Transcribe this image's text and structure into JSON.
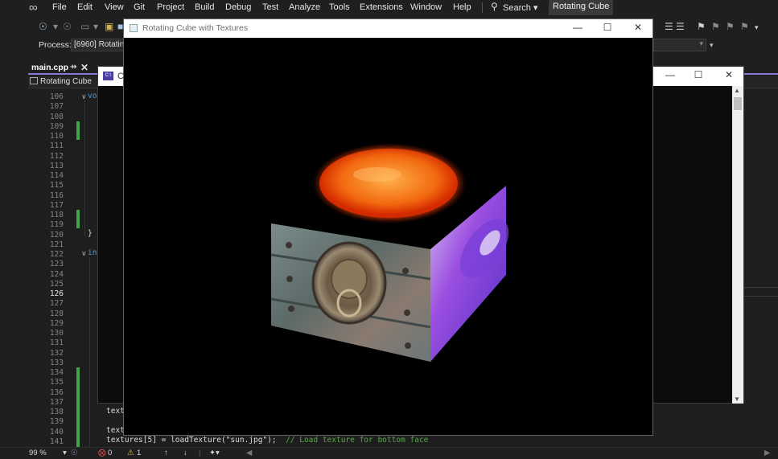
{
  "ide": {
    "menu": [
      "File",
      "Edit",
      "View",
      "Git",
      "Project",
      "Build",
      "Debug",
      "Test",
      "Analyze",
      "Tools",
      "Extensions",
      "Window",
      "Help"
    ],
    "search_label": "Search",
    "solution_name": "Rotating Cube",
    "process_label": "Process:",
    "process_value": "[6960] Rotatin",
    "tab_label": "main.cpp",
    "tab_pin": "⇸",
    "tab_close": "✕",
    "nav_project": "Rotating Cube",
    "line_numbers": [
      "106",
      "107",
      "108",
      "109",
      "110",
      "111",
      "112",
      "113",
      "114",
      "115",
      "116",
      "117",
      "118",
      "119",
      "120",
      "121",
      "122",
      "123",
      "124",
      "125",
      "126",
      "127",
      "128",
      "129",
      "130",
      "131",
      "132",
      "133",
      "134",
      "135",
      "136",
      "137",
      "138",
      "139",
      "140",
      "141"
    ],
    "current_line": "126",
    "code_frag_106": "vo",
    "code_frag_122": "in",
    "code_brace_120": "}",
    "code_138": "text",
    "code_140": "text",
    "code_141_a": "textures[5] = loadTexture(\"sun.jpg\");",
    "code_141_b": "// Load texture for bottom face",
    "status": {
      "zoom": "99 %",
      "errors": "0",
      "warnings": "1"
    }
  },
  "console_window": {
    "title": "C",
    "minimize": "—",
    "maximize": "☐",
    "close": "✕"
  },
  "gl_window": {
    "title": "Rotating Cube with Textures",
    "minimize": "—",
    "maximize": "☐",
    "close": "✕"
  },
  "scene": {
    "description_faces": [
      "sun texture (top)",
      "lion door knocker (front)",
      "purple flower (right)"
    ],
    "colors": {
      "accent_tab": "#8b76d4",
      "change_bar": "#3fa548",
      "error": "#e05252",
      "warning": "#e2c04f",
      "sun_core": "#ff8a1a",
      "sun_edge": "#d42a00",
      "metal": "#6f7e7e",
      "flower": "#9b4fe0"
    }
  }
}
